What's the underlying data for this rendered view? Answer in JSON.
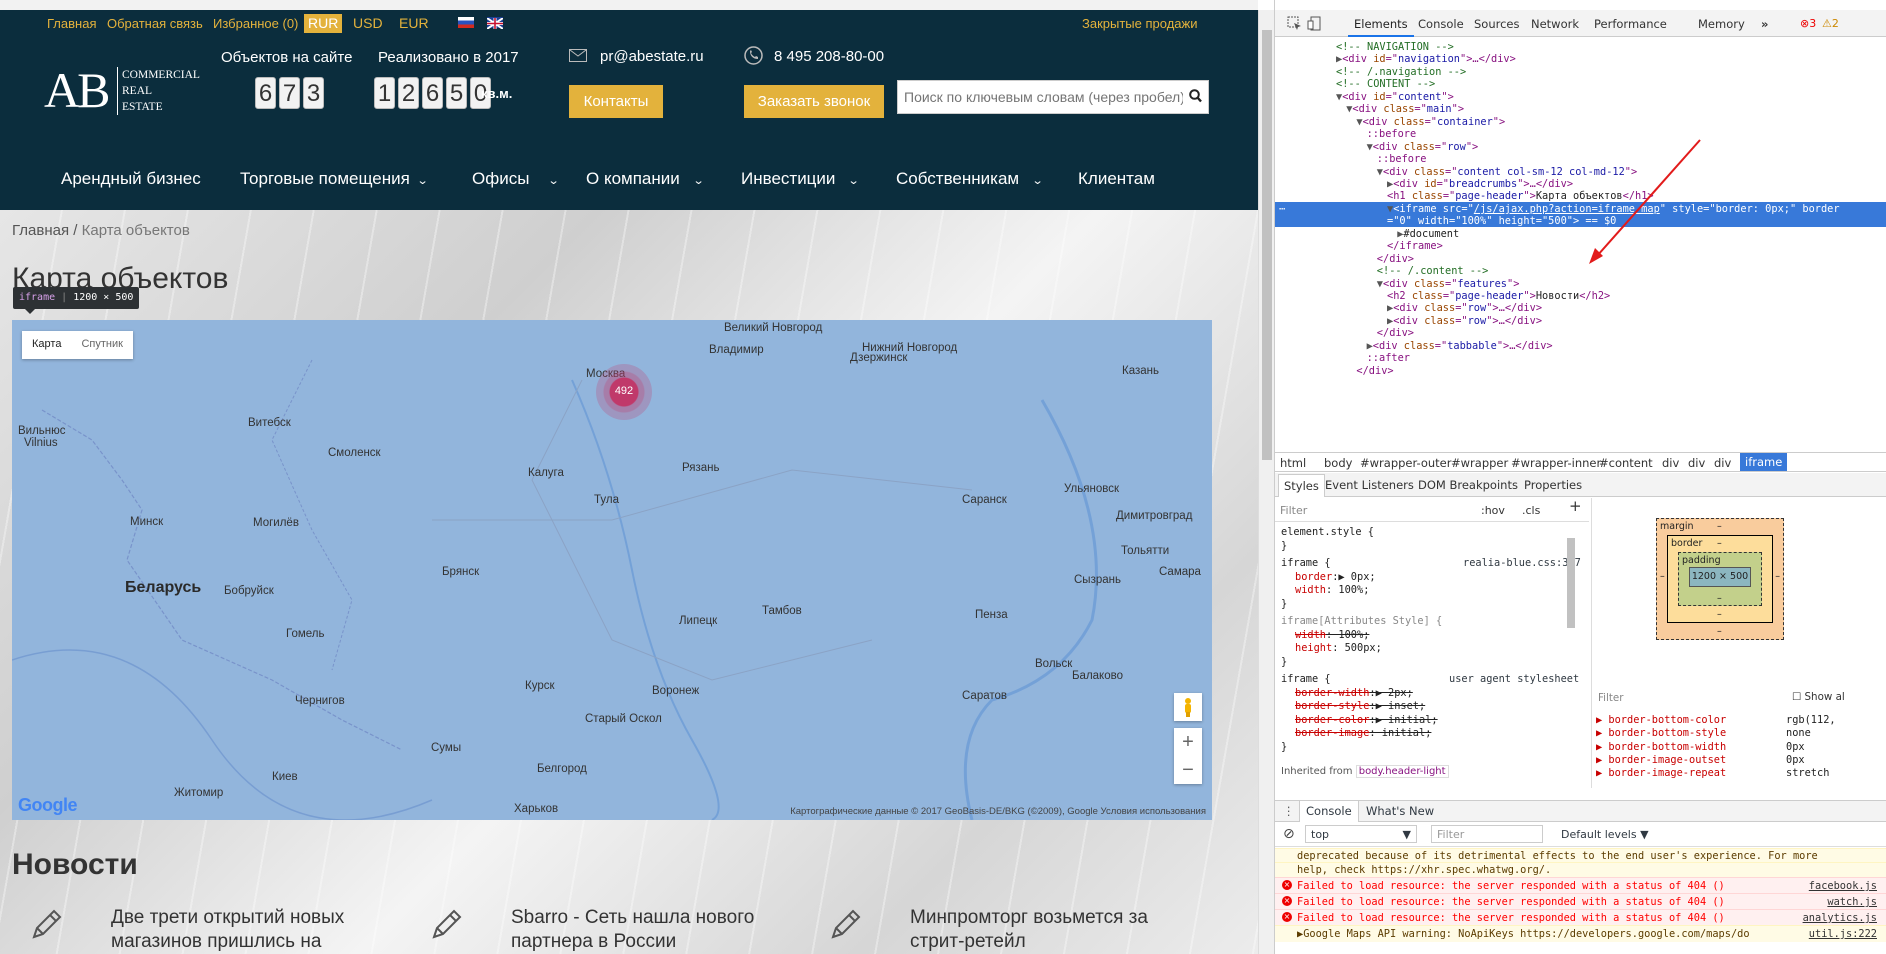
{
  "site": {
    "topbar": {
      "links": [
        "Главная",
        "Обратная связь",
        "Избранное (0)"
      ],
      "currencies": [
        "RUR",
        "USD",
        "EUR"
      ],
      "closed_sales": "Закрытые продажи"
    },
    "logo": {
      "mark": "AB",
      "line1": "COMMERCIAL",
      "line2": "REAL",
      "line3": "ESTATE"
    },
    "stats": [
      {
        "label": "Объектов на сайте",
        "digits": [
          "6",
          "7",
          "3"
        ],
        "unit": ""
      },
      {
        "label": "Реализовано в 2017",
        "digits": [
          "1",
          "2",
          "6",
          "5",
          "0"
        ],
        "unit": "кв.м."
      }
    ],
    "email": "pr@abestate.ru",
    "phone": "8 495 208-80-00",
    "contacts_button": "Контакты",
    "callback_button": "Заказать звонок",
    "search_placeholder": "Поиск по ключевым словам (через пробел)",
    "nav": [
      {
        "label": "Арендный бизнес",
        "dropdown": false
      },
      {
        "label": "Торговые помещения",
        "dropdown": true
      },
      {
        "label": "Офисы",
        "dropdown": true
      },
      {
        "label": "О компании",
        "dropdown": true
      },
      {
        "label": "Инвестиции",
        "dropdown": true
      },
      {
        "label": "Собственникам",
        "dropdown": true
      },
      {
        "label": "Клиентам",
        "dropdown": false
      }
    ],
    "breadcrumb": {
      "home": "Главная",
      "sep": " / ",
      "current": "Карта объектов"
    },
    "page_title": "Карта объектов",
    "inspect_tooltip": {
      "tag": "iframe",
      "size": "1200 × 500"
    },
    "map": {
      "types": [
        "Карта",
        "Спутник"
      ],
      "cluster_count": "492",
      "attribution": "Картографические данные © 2017 GeoBasis-DE/BKG (©2009), Google    Условия использования",
      "google": "Google",
      "cities": [
        {
          "name": "Великий Новгород",
          "big": false
        },
        {
          "name": "Нижний Новгород",
          "big": false
        },
        {
          "name": "Владимир",
          "big": false
        },
        {
          "name": "Дзержинск",
          "big": false
        },
        {
          "name": "Москва",
          "big": false
        },
        {
          "name": "Казань",
          "big": false
        },
        {
          "name": "Витебск",
          "big": false
        },
        {
          "name": "Вильнюс",
          "big": false
        },
        {
          "name": "Vilnius",
          "big": false
        },
        {
          "name": "Смоленск",
          "big": false
        },
        {
          "name": "Калуга",
          "big": false
        },
        {
          "name": "Рязань",
          "big": false
        },
        {
          "name": "Ульяновск",
          "big": false
        },
        {
          "name": "Минск",
          "big": false
        },
        {
          "name": "Могилёв",
          "big": false
        },
        {
          "name": "Бобруйск",
          "big": false
        },
        {
          "name": "Беларусь",
          "big": true
        },
        {
          "name": "Тула",
          "big": false
        },
        {
          "name": "Саранск",
          "big": false
        },
        {
          "name": "Димитровград",
          "big": false
        },
        {
          "name": "Брянск",
          "big": false
        },
        {
          "name": "Тольятти",
          "big": false
        },
        {
          "name": "Самара",
          "big": false
        },
        {
          "name": "Сызрань",
          "big": false
        },
        {
          "name": "Гомель",
          "big": false
        },
        {
          "name": "Тамбов",
          "big": false
        },
        {
          "name": "Липецк",
          "big": false
        },
        {
          "name": "Пенза",
          "big": false
        },
        {
          "name": "Курск",
          "big": false
        },
        {
          "name": "Воронеж",
          "big": false
        },
        {
          "name": "Чернигов",
          "big": false
        },
        {
          "name": "Саратов",
          "big": false
        },
        {
          "name": "Вольск",
          "big": false
        },
        {
          "name": "Балаково",
          "big": false
        },
        {
          "name": "Старый Оскол",
          "big": false
        },
        {
          "name": "Сумы",
          "big": false
        },
        {
          "name": "Белгород",
          "big": false
        },
        {
          "name": "Киев",
          "big": false
        },
        {
          "name": "Житомир",
          "big": false
        },
        {
          "name": "Харьков",
          "big": false
        }
      ]
    },
    "news_heading": "Новости",
    "news": [
      {
        "line1": "Две трети открытий новых",
        "line2": "магазинов пришлись на"
      },
      {
        "line1": "Sbarro - Сеть нашла нового",
        "line2": "партнера в России"
      },
      {
        "line1": "Минпромторг возьмется за",
        "line2": "стрит-ретейл"
      }
    ]
  },
  "devtools": {
    "tabs": [
      "Elements",
      "Console",
      "Sources",
      "Network",
      "Performance",
      "Memory"
    ],
    "more": "»",
    "errors": "3",
    "warnings": "2",
    "dom_lines": [
      {
        "indent": 5,
        "html": "<span class='cm'>&lt;!-- NAVIGATION --&gt;</span>"
      },
      {
        "indent": 5,
        "arrow": "▶",
        "html": "<span class='tag'>&lt;div </span><span class='an'>id</span>=\"<span class='av'>navigation</span>\"<span class='tag'>&gt;</span>…<span class='tag'>&lt;/div&gt;</span>"
      },
      {
        "indent": 5,
        "html": "<span class='cm'>&lt;!-- /.navigation --&gt;</span>"
      },
      {
        "indent": 5,
        "html": "<span class='cm'>&lt;!-- CONTENT --&gt;</span>"
      },
      {
        "indent": 5,
        "arrow": "▼",
        "html": "<span class='tag'>&lt;div </span><span class='an'>id</span>=\"<span class='av'>content</span>\"<span class='tag'>&gt;</span>"
      },
      {
        "indent": 6,
        "arrow": "▼",
        "html": "<span class='tag'>&lt;div </span><span class='an'>class</span>=\"<span class='av'>main</span>\"<span class='tag'>&gt;</span>"
      },
      {
        "indent": 7,
        "arrow": "▼",
        "html": "<span class='tag'>&lt;div </span><span class='an'>class</span>=\"<span class='av'>container</span>\"<span class='tag'>&gt;</span>"
      },
      {
        "indent": 8,
        "html": "<span class='ps'>::before</span>"
      },
      {
        "indent": 8,
        "arrow": "▼",
        "html": "<span class='tag'>&lt;div </span><span class='an'>class</span>=\"<span class='av'>row</span>\"<span class='tag'>&gt;</span>"
      },
      {
        "indent": 9,
        "html": "<span class='ps'>::before</span>"
      },
      {
        "indent": 9,
        "arrow": "▼",
        "html": "<span class='tag'>&lt;div </span><span class='an'>class</span>=\"<span class='av'>content col-sm-12 col-md-12</span>\"<span class='tag'>&gt;</span>"
      },
      {
        "indent": 10,
        "arrow": "▶",
        "html": "<span class='tag'>&lt;div </span><span class='an'>id</span>=\"<span class='av'>breadcrumbs</span>\"<span class='tag'>&gt;</span>…<span class='tag'>&lt;/div&gt;</span>"
      },
      {
        "indent": 10,
        "html": "<span class='tag'>&lt;h1 </span><span class='an'>class</span>=\"<span class='av'>page-header</span>\"<span class='tag'>&gt;</span><span class='tx'>Карта объектов</span><span class='tag'>&lt;/h1&gt;</span>"
      },
      {
        "indent": 10,
        "arrow": "▼",
        "selected": true,
        "html": "&lt;iframe src=\"<u>/js/ajax.php?action=iframe_map</u>\" style=\"border: 0px;\" border"
      },
      {
        "indent": 10,
        "selected": true,
        "html": "=\"0\" width=\"100%\" height=\"500\"&gt; == $0"
      },
      {
        "indent": 11,
        "arrow": "▶",
        "html": "<span class='tx'>#document</span>"
      },
      {
        "indent": 10,
        "html": "<span class='tag'>&lt;/iframe&gt;</span>"
      },
      {
        "indent": 9,
        "html": "<span class='tag'>&lt;/div&gt;</span>"
      },
      {
        "indent": 9,
        "html": "<span class='cm'>&lt;!-- /.content --&gt;</span>"
      },
      {
        "indent": 9,
        "arrow": "▼",
        "html": "<span class='tag'>&lt;div </span><span class='an'>class</span>=\"<span class='av'>features</span>\"<span class='tag'>&gt;</span>"
      },
      {
        "indent": 10,
        "html": "<span class='tag'>&lt;h2 </span><span class='an'>class</span>=\"<span class='av'>page-header</span>\"<span class='tag'>&gt;</span><span class='tx'>Новости</span><span class='tag'>&lt;/h2&gt;</span>"
      },
      {
        "indent": 10,
        "arrow": "▶",
        "html": "<span class='tag'>&lt;div </span><span class='an'>class</span>=\"<span class='av'>row</span>\"<span class='tag'>&gt;</span>…<span class='tag'>&lt;/div&gt;</span>"
      },
      {
        "indent": 10,
        "arrow": "▶",
        "html": "<span class='tag'>&lt;div </span><span class='an'>class</span>=\"<span class='av'>row</span>\"<span class='tag'>&gt;</span>…<span class='tag'>&lt;/div&gt;</span>"
      },
      {
        "indent": 9,
        "html": "<span class='tag'>&lt;/div&gt;</span>"
      },
      {
        "indent": 8,
        "arrow": "▶",
        "html": "<span class='tag'>&lt;div </span><span class='an'>class</span>=\"<span class='av'>tabbable</span>\"<span class='tag'>&gt;</span>…<span class='tag'>&lt;/div&gt;</span>"
      },
      {
        "indent": 8,
        "html": "<span class='ps'>::after</span>"
      },
      {
        "indent": 7,
        "html": "<span class='tag'>&lt;/div&gt;</span>"
      }
    ],
    "crumbs": [
      "html",
      "body",
      "#wrapper-outer",
      "#wrapper",
      "#wrapper-inner",
      "#content",
      "div",
      "div",
      "div",
      "iframe"
    ],
    "style_tabs": [
      "Styles",
      "Event Listeners",
      "DOM Breakpoints",
      "Properties"
    ],
    "styles_filter": "Filter",
    "styles_hov": ":hov",
    "styles_cls": ".cls",
    "style_rules": [
      {
        "sel": "element.style {",
        "lines": [],
        "src": ""
      },
      {
        "sel": "iframe {",
        "lines": [
          {
            "p": "border",
            "v": "▶ 0px;",
            "strike": false
          },
          {
            "p": "width",
            "v": " 100%;",
            "strike": false
          }
        ],
        "src": "realia-blue.css:347"
      },
      {
        "sel": "iframe[Attributes Style] {",
        "lines": [
          {
            "p": "width",
            "v": " 100%;",
            "strike": true
          },
          {
            "p": "height",
            "v": " 500px;",
            "strike": false
          }
        ],
        "src": ""
      },
      {
        "sel": "iframe {",
        "lines": [
          {
            "p": "border-width",
            "v": "▶ 2px;",
            "strike": true
          },
          {
            "p": "border-style",
            "v": "▶ inset;",
            "strike": true
          },
          {
            "p": "border-color",
            "v": "▶ initial;",
            "strike": true
          },
          {
            "p": "border-image",
            "v": " initial;",
            "strike": true
          }
        ],
        "src": "user agent stylesheet"
      }
    ],
    "inherited": "Inherited from",
    "inherited_sel": "body.header-light",
    "box_model": {
      "margin": "margin",
      "border": "border",
      "padding": "padding",
      "content": "1200 × 500",
      "dash": "–"
    },
    "computed_filter": "Filter",
    "show_all": "Show al",
    "computed": [
      {
        "k": "border-bottom-color",
        "v": "rgb(112,"
      },
      {
        "k": "border-bottom-style",
        "v": "none"
      },
      {
        "k": "border-bottom-width",
        "v": "0px"
      },
      {
        "k": "border-image-outset",
        "v": "0px"
      },
      {
        "k": "border-image-repeat",
        "v": "stretch"
      }
    ],
    "console_tabs": [
      "Console",
      "What's New"
    ],
    "console_context": "top",
    "console_filter": "Filter",
    "console_levels": "Default levels",
    "console_msgs": [
      {
        "type": "warn",
        "text": "deprecated because of its detrimental effects to the end user's experience. For more",
        "src": ""
      },
      {
        "type": "warn",
        "text": "help, check https://xhr.spec.whatwg.org/.",
        "src": ""
      },
      {
        "type": "err",
        "text": "Failed to load resource: the server responded with a status of 404 ()",
        "src": "facebook.js"
      },
      {
        "type": "err",
        "text": "Failed to load resource: the server responded with a status of 404 ()",
        "src": "watch.js"
      },
      {
        "type": "err",
        "text": "Failed to load resource: the server responded with a status of 404 ()",
        "src": "analytics.js"
      },
      {
        "type": "warn",
        "text": "▶Google Maps API warning: NoApiKeys https://developers.google.com/maps/do",
        "src": "util.js:222"
      }
    ]
  }
}
